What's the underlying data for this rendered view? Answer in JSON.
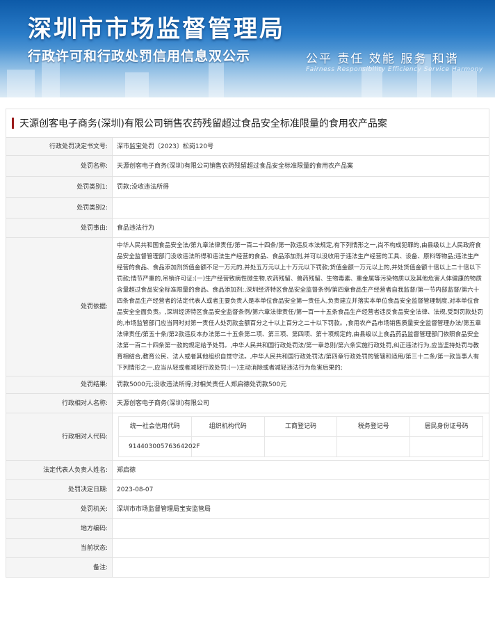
{
  "banner": {
    "title": "深圳市市场监督管理局",
    "subtitle": "行政许可和行政处罚信用信息双公示",
    "slogan": "公平  责任  效能  服务  和谐",
    "slogan_en": "Fairness  Responsibility  Efficiency  Service  Harmony"
  },
  "case_title": "天源创客电子商务(深圳)有限公司销售农药残留超过食品安全标准限量的食用农产品案",
  "rows": {
    "doc_no": {
      "label": "行政处罚决定书文号:",
      "value": "深市监宝处罚〔2023〕松岗120号"
    },
    "name": {
      "label": "处罚名称:",
      "value": "天源创客电子商务(深圳)有限公司销售农药残留超过食品安全标准限量的食用农产品案"
    },
    "cat1": {
      "label": "处罚类别1:",
      "value": "罚款;没收违法所得"
    },
    "cat2": {
      "label": "处罚类别2:",
      "value": ""
    },
    "reason": {
      "label": "处罚事由:",
      "value": "食品违法行为"
    },
    "basis": {
      "label": "处罚依据:",
      "value": "中华人民共和国食品安全法/第九章法律责任/第一百二十四条/第一款违反本法规定,有下列情形之一,尚不构成犯罪的,由县级以上人民政府食品安全监督管理部门没收违法所得和违法生产经营的食品、食品添加剂,并可以没收用于违法生产经营的工具、设备、原料等物品;违法生产经营的食品、食品添加剂货值金额不足一万元的,并处五万元以上十万元以下罚款;货值金额一万元以上的,并处货值金额十倍以上二十倍以下罚款;情节严重的,吊销许可证:(一)生产经营致病性微生物,农药残留、兽药残留、生物毒素、重金属等污染物质以及其他危害人体健康的物质含量超过食品安全标准限量的食品、食品添加剂;,深圳经济特区食品安全监督条例/第四章食品生产经营者自我监督/第一节内部监督/第六十四条食品生产经营者的法定代表人或者主要负责人是本单位食品安全第一责任人,负责建立并落实本单位食品安全监督管理制度,对本单位食品安全全面负责。,深圳经济特区食品安全监督条例/第六章法律责任/第一百一十五条食品生产经营者违反食品安全法律、法规,受到罚款处罚的,市场监管部门应当同时对第一责任人处罚款金额百分之十以上百分之二十以下罚款。,食用农产品市场销售质量安全监督管理办法/第五章法律责任/第五十条/第2款违反本办法第二十五条第二项、第三项、第四项、第十项规定的,由县级以上食品药品监督管理部门依照食品安全法第一百二十四条第一款的规定给予处罚。,中华人民共和国行政处罚法/第一章总则/第六条实施行政处罚,纠正违法行为,应当坚持处罚与教育相结合,教育公民、法人或者其他组织自觉守法。,中华人民共和国行政处罚法/第四章行政处罚的管辖和适用/第三十二条/第一款当事人有下列情形之一,应当从轻或者减轻行政处罚:(一)主动消除或者减轻违法行为危害后果的;"
    },
    "result": {
      "label": "处罚结果:",
      "value": "罚款5000元;没收违法所得;对相关责任人郑启德处罚款500元"
    },
    "party": {
      "label": "行政相对人名称:",
      "value": "天源创客电子商务(深圳)有限公司"
    },
    "codes": {
      "label": "行政相对人代码:",
      "headers": [
        "统一社会信用代码",
        "组织机构代码",
        "工商登记码",
        "税务登记号",
        "居民身份证号码"
      ],
      "values": [
        "91440300576364202F",
        "",
        "",
        "",
        ""
      ]
    },
    "legal_rep": {
      "label": "法定代表人负责人姓名:",
      "value": "郑启德"
    },
    "date": {
      "label": "处罚决定日期:",
      "value": "2023-08-07"
    },
    "authority": {
      "label": "处罚机关:",
      "value": "深圳市市场监督管理局宝安监管局"
    },
    "area_code": {
      "label": "地方编码:",
      "value": ""
    },
    "status": {
      "label": "当前状态:",
      "value": ""
    },
    "remark": {
      "label": "备注:",
      "value": ""
    }
  },
  "colors": {
    "accent_bar": "#9b1b1b",
    "label_bg": "#f5f5f5",
    "border": "#e1e1e1"
  }
}
